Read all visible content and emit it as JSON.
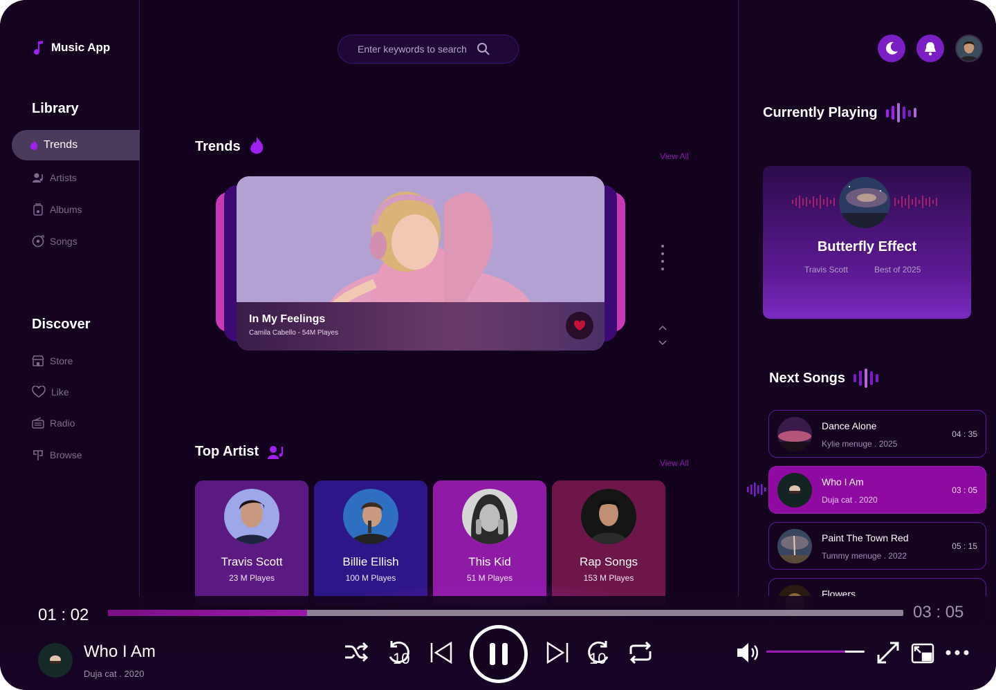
{
  "app": {
    "title": "Music App"
  },
  "sidebar": {
    "library_title": "Library",
    "library_items": [
      {
        "label": "Trends",
        "icon": "flame-icon",
        "active": true
      },
      {
        "label": "Artists",
        "icon": "artist-icon"
      },
      {
        "label": "Albums",
        "icon": "album-icon"
      },
      {
        "label": "Songs",
        "icon": "disc-icon"
      }
    ],
    "discover_title": "Discover",
    "discover_items": [
      {
        "label": "Store",
        "icon": "store-icon"
      },
      {
        "label": "Like",
        "icon": "heart-icon"
      },
      {
        "label": "Radio",
        "icon": "radio-icon"
      },
      {
        "label": "Browse",
        "icon": "browse-icon"
      }
    ]
  },
  "search": {
    "placeholder": "Enter keywords to search"
  },
  "trends": {
    "title": "Trends",
    "view_all": "View All",
    "featured": {
      "title": "In My Feelings",
      "subtitle": "Camila Cabello - 54M Playes"
    }
  },
  "top_artist": {
    "title": "Top Artist",
    "view_all": "View All",
    "artists": [
      {
        "name": "Travis Scott",
        "plays": "23 M Playes",
        "color": "#5b1a82"
      },
      {
        "name": "Billie Ellish",
        "plays": "100 M Playes",
        "color": "#2c1688"
      },
      {
        "name": "This Kid",
        "plays": "51 M Playes",
        "color": "#8e1aa6"
      },
      {
        "name": "Rap Songs",
        "plays": "153 M Playes",
        "color": "#6e1649"
      }
    ]
  },
  "currently_playing": {
    "title": "Currently Playing",
    "song": "Butterfly Effect",
    "artist": "Travis Scott",
    "album": "Best of 2025"
  },
  "next_songs": {
    "title": "Next Songs",
    "items": [
      {
        "title": "Dance Alone",
        "sub": "Kylie menuge . 2025",
        "duration": "04 : 35",
        "active": false
      },
      {
        "title": "Who I Am",
        "sub": "Duja cat . 2020",
        "duration": "03 : 05",
        "active": true
      },
      {
        "title": "Paint The Town Red",
        "sub": "Tummy menuge . 2022",
        "duration": "05 : 15",
        "active": false
      },
      {
        "title": "Flowers",
        "sub": "",
        "duration": "",
        "active": false
      }
    ]
  },
  "player": {
    "elapsed": "01 : 02",
    "total": "03 : 05",
    "progress": 0.25,
    "volume": 0.8,
    "title": "Who I Am",
    "sub": "Duja cat . 2020",
    "skip_back": "10",
    "skip_forward": "10"
  },
  "colors": {
    "accent": "#a01ab5",
    "background": "#12021e",
    "primary": "#7a1fc4"
  }
}
